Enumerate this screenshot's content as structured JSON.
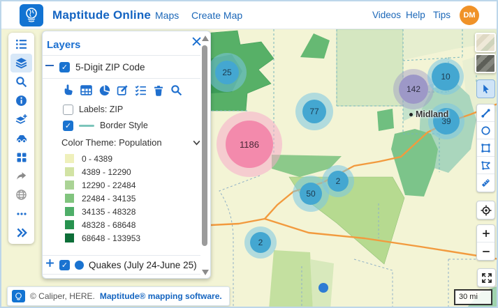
{
  "header": {
    "app_title": "Maptitude Online",
    "nav_maps": "Maps",
    "nav_create_map": "Create Map",
    "nav_videos": "Videos",
    "nav_help": "Help",
    "nav_tips": "Tips",
    "avatar_initials": "DM"
  },
  "sidebar_icons": [
    "list",
    "layers",
    "search",
    "info",
    "add-layer",
    "vehicle",
    "apps-grid",
    "share",
    "web",
    "more",
    "collapse"
  ],
  "layers_panel": {
    "title": "Layers",
    "zip_layer": {
      "name": "5-Digit ZIP Code",
      "toolbar_icons": [
        "select-hand",
        "table",
        "pie-chart",
        "edit",
        "list-check",
        "delete",
        "search"
      ],
      "labels_label": "Labels: ZIP",
      "border_style_label": "Border Style",
      "color_theme_label": "Color Theme: Population",
      "legend": [
        {
          "range": "0 - 4389",
          "color": "#eff0bb"
        },
        {
          "range": "4389 - 12290",
          "color": "#d2e3a4"
        },
        {
          "range": "12290 - 22484",
          "color": "#aad395"
        },
        {
          "range": "22484 - 34135",
          "color": "#81c47e"
        },
        {
          "range": "34135 - 48328",
          "color": "#4fae69"
        },
        {
          "range": "48328 - 68648",
          "color": "#27924f"
        },
        {
          "range": "68648 - 133953",
          "color": "#0d6e38"
        }
      ]
    },
    "quakes_layer": {
      "name": "Quakes (July 24-June 25)"
    }
  },
  "map": {
    "city_label": "Midland",
    "scale_label": "30 mi",
    "clusters": [
      {
        "value": "25",
        "type": "blue"
      },
      {
        "value": "142",
        "type": "purple"
      },
      {
        "value": "10",
        "type": "blue"
      },
      {
        "value": "77",
        "type": "blue"
      },
      {
        "value": "39",
        "type": "blue"
      },
      {
        "value": "1186",
        "type": "pink"
      },
      {
        "value": "2",
        "type": "blue"
      },
      {
        "value": "50",
        "type": "blue"
      },
      {
        "value": "2",
        "type": "blue"
      }
    ]
  },
  "right_toolbar_icons": [
    "basemap-street",
    "basemap-satellite",
    "pointer",
    "draw-line",
    "draw-circle",
    "draw-rectangle",
    "draw-polygon",
    "measure-ruler",
    "locate",
    "zoom-in",
    "zoom-out",
    "fullscreen"
  ],
  "attribution": {
    "copyright": "© Caliper, HERE.",
    "link": "Maptitude® mapping software."
  },
  "colors": {
    "accent_blue": "#1a6fd0",
    "avatar_orange": "#f09228",
    "road_orange": "#f29a3e",
    "cluster_blue": "#44a7d1",
    "cluster_purple": "#9d98c7",
    "cluster_pink": "#f38aac"
  }
}
